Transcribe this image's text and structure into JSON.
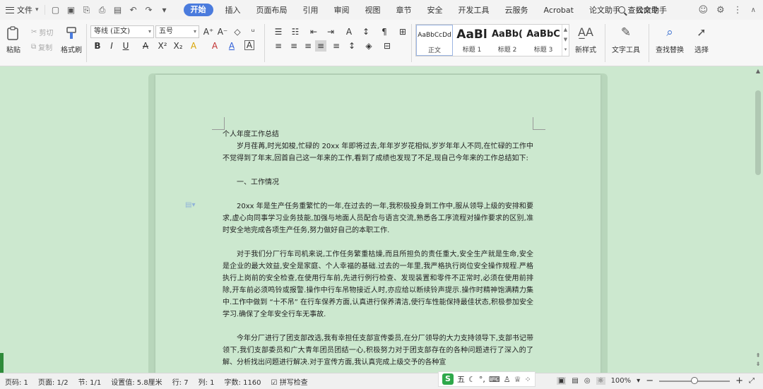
{
  "menubar": {
    "file_label": "文件",
    "tabs": [
      "开始",
      "插入",
      "页面布局",
      "引用",
      "审阅",
      "视图",
      "章节",
      "安全",
      "开发工具",
      "云服务",
      "Acrobat",
      "论文助手",
      "公文助手"
    ],
    "active_tab": "开始",
    "search_label": "查找命令",
    "accent_color": "#4a7bdd"
  },
  "ribbon": {
    "paste": "粘贴",
    "cut": "剪切",
    "copy": "复制",
    "format_painter": "格式刷",
    "font_name": "等线 (正文)",
    "font_size": "五号",
    "styles": [
      {
        "sample": "AaBbCcDd",
        "label": "正文"
      },
      {
        "sample": "AaBl",
        "label": "标题 1"
      },
      {
        "sample": "AaBb(",
        "label": "标题 2"
      },
      {
        "sample": "AaBbC",
        "label": "标题 3"
      }
    ],
    "new_style": "新样式",
    "text_tools": "文字工具",
    "find_replace": "查找替换",
    "select": "选择"
  },
  "document": {
    "title": "个人年度工作总结",
    "p1": "岁月荏苒,时光如梭,忙碌的 20xx 年即将过去,年年岁岁花相似,岁岁年年人不同,在忙碌的工作中不觉得到了年末,回首自己这一年来的工作,看到了成绩也发现了不足,现自己今年来的工作总结如下:",
    "h1": "一、工作情况",
    "p2": "20xx 年是生产任务重繁忙的一年,在过去的一年,我积极投身到工作中,服从领导上级的安排和要求,虚心向同事学习业务技能,加强与地面人员配合与语言交流,熟悉各工序流程对操作要求的区别,准时安全地完成各项生产任务,努力做好自己的本职工作.",
    "p3": "对于我们分厂行车司机来说,工作任务繁重枯燥,而且所担负的责任重大,安全生产就是生命,安全是企业的最大效益,安全是家庭、个人幸福的基础.过去的一年里,我严格执行岗位安全操作规程.严格执行上岗前的安全检查,在使用行车前,先进行例行检查、发现装置和零件不正常时,必须在使用前排除,开车前必须鸣铃或报警.操作中行车吊物接近人时,亦应给以断续铃声提示.操作时精神饱满精力集中.工作中做到 “十不吊” 在行车保养方面,认真进行保养清洁,使行车性能保持最佳状态,积极参加安全学习.确保了全年安全行车无事故.",
    "p4": "今年分厂进行了团支部改选,我有幸担任支部宣传委员,在分厂领导的大力支持领导下,支部书记带领下,我们支部委员和广大青年团员团结一心,积极努力对于团支部存在的各种问题进行了深入的了解、分析找出问题进行解决.对于宣传方面,我认真完成上级交予的各种宣"
  },
  "status": {
    "page_no": "页码: 1",
    "pages": "页面: 1/2",
    "section": "节: 1/1",
    "setting": "设置值: 5.8厘米",
    "row": "行: 7",
    "col": "列: 1",
    "words": "字数: 1160",
    "spell": "拼写检查",
    "ime_label": "五",
    "zoom": "100%",
    "zoom_fraction": 0.5
  }
}
